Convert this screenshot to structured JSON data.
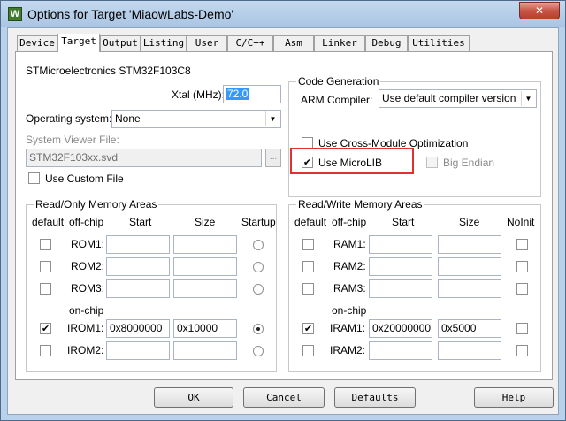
{
  "window": {
    "title": "Options for Target 'MiaowLabs-Demo'",
    "close_glyph": "✕",
    "app_icon_glyph": "W"
  },
  "tabs": [
    "Device",
    "Target",
    "Output",
    "Listing",
    "User",
    "C/C++",
    "Asm",
    "Linker",
    "Debug",
    "Utilities"
  ],
  "active_tab": "Target",
  "device": {
    "name": "STMicroelectronics STM32F103C8",
    "xtal_label": "Xtal (MHz):",
    "xtal_value": "72.0",
    "os_label": "Operating system:",
    "os_value": "None",
    "svf_label": "System Viewer File:",
    "svf_value": "STM32F103xx.svd",
    "svf_browse": "...",
    "use_custom_file": {
      "label": "Use Custom File",
      "checked": false
    }
  },
  "code_generation": {
    "title": "Code Generation",
    "compiler_label": "ARM Compiler:",
    "compiler_value": "Use default compiler version",
    "cross_module": {
      "label": "Use Cross-Module Optimization",
      "checked": false
    },
    "microlib": {
      "label": "Use MicroLIB",
      "checked": true
    },
    "big_endian": {
      "label": "Big Endian",
      "checked": false,
      "disabled": true
    }
  },
  "ro_memory": {
    "title": "Read/Only Memory Areas",
    "headers": {
      "default": "default",
      "offchip": "off-chip",
      "start": "Start",
      "size": "Size",
      "startup": "Startup"
    },
    "onchip_label": "on-chip",
    "rows": [
      {
        "name": "ROM1:",
        "default": false,
        "start": "",
        "size": "",
        "startup": false
      },
      {
        "name": "ROM2:",
        "default": false,
        "start": "",
        "size": "",
        "startup": false
      },
      {
        "name": "ROM3:",
        "default": false,
        "start": "",
        "size": "",
        "startup": false
      },
      {
        "name": "IROM1:",
        "default": true,
        "start": "0x8000000",
        "size": "0x10000",
        "startup": true
      },
      {
        "name": "IROM2:",
        "default": false,
        "start": "",
        "size": "",
        "startup": false
      }
    ]
  },
  "rw_memory": {
    "title": "Read/Write Memory Areas",
    "headers": {
      "default": "default",
      "offchip": "off-chip",
      "start": "Start",
      "size": "Size",
      "noinit": "NoInit"
    },
    "onchip_label": "on-chip",
    "rows": [
      {
        "name": "RAM1:",
        "default": false,
        "start": "",
        "size": "",
        "noinit": false
      },
      {
        "name": "RAM2:",
        "default": false,
        "start": "",
        "size": "",
        "noinit": false
      },
      {
        "name": "RAM3:",
        "default": false,
        "start": "",
        "size": "",
        "noinit": false
      },
      {
        "name": "IRAM1:",
        "default": true,
        "start": "0x20000000",
        "size": "0x5000",
        "noinit": false
      },
      {
        "name": "IRAM2:",
        "default": false,
        "start": "",
        "size": "",
        "noinit": false
      }
    ]
  },
  "buttons": {
    "ok": "OK",
    "cancel": "Cancel",
    "defaults": "Defaults",
    "help": "Help"
  },
  "colors": {
    "highlight_box": "#e03030",
    "selection": "#3399ff",
    "title_bar": "#b9d1ea"
  }
}
